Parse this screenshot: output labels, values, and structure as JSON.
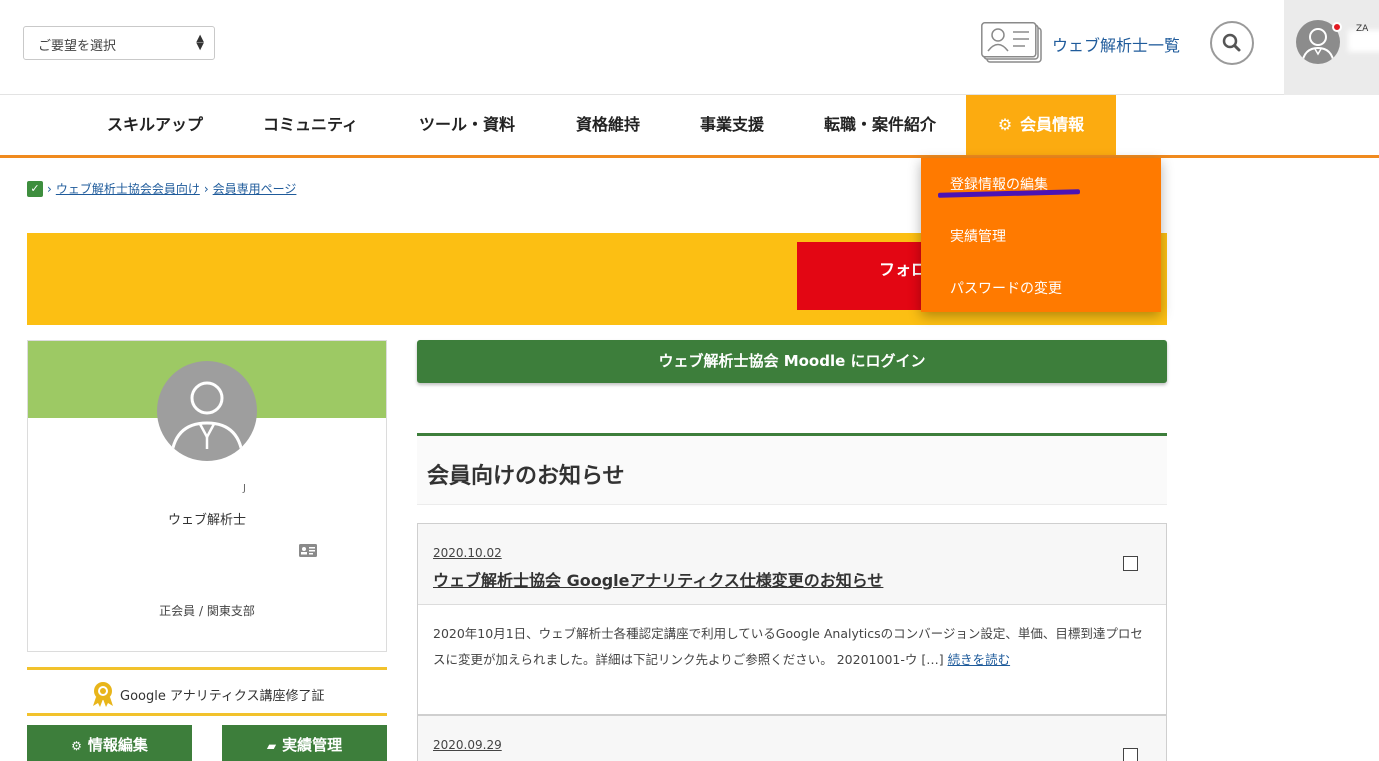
{
  "header": {
    "select_value": "ご要望を選択",
    "list_link": "ウェブ解析士一覧",
    "user_name_fragment": "ZA"
  },
  "nav": {
    "items": [
      "スキルアップ",
      "コミュニティ",
      "ツール・資料",
      "資格維持",
      "事業支援",
      "転職・案件紹介"
    ],
    "active": "会員情報"
  },
  "breadcrumb": {
    "items": [
      "ウェブ解析士協会会員向け",
      "会員専用ページ"
    ]
  },
  "banner": {
    "button_label": "フォロ"
  },
  "dropdown": {
    "items": [
      "登録情報の編集",
      "実績管理",
      "パスワードの変更"
    ]
  },
  "profile": {
    "title": "ウェブ解析士",
    "membership": "正会員 / 関東支部",
    "mark": "J"
  },
  "certificate": {
    "label": "Google アナリティクス講座修了証"
  },
  "sidebar_buttons": {
    "edit": "情報編集",
    "achievements": "実績管理"
  },
  "main": {
    "moodle_button": "ウェブ解析士協会 Moodle にログイン",
    "notice_title": "会員向けのお知らせ",
    "news": [
      {
        "date": "2020.10.02",
        "title": "ウェブ解析士協会 Googleアナリティクス仕様変更のお知らせ",
        "excerpt": "2020年10月1日、ウェブ解析士各種認定講座で利用しているGoogle Analyticsのコンバージョン設定、単価、目標到達プロセスに変更が加えられました。詳細は下記リンク先よりご参照ください。 20201001-ウ […] ",
        "read_more": "続きを読む"
      },
      {
        "date": "2020.09.29"
      }
    ]
  },
  "colors": {
    "accent_orange": "#fcab10",
    "dropdown_orange": "#ff7a00",
    "banner_yellow": "#fcbf13",
    "green": "#3d7e3b",
    "red": "#e30613",
    "link_blue": "#1f5b9b"
  }
}
